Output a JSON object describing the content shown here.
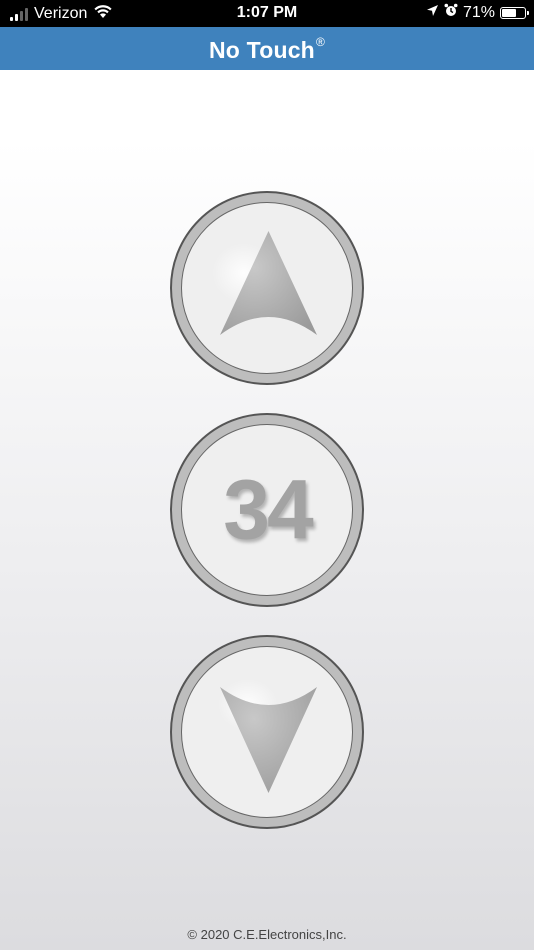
{
  "status_bar": {
    "carrier": "Verizon",
    "time": "1:07 PM",
    "battery_percent": "71%",
    "battery_level": 0.71,
    "icons": [
      "signal-icon",
      "wifi-icon",
      "location-icon",
      "alarm-icon",
      "battery-icon"
    ]
  },
  "nav": {
    "title": "No Touch",
    "registered_mark": "®",
    "background_color": "#3f82bd"
  },
  "controls": {
    "up_button": {
      "icon": "arrow-up-icon"
    },
    "floor_display": {
      "value": "34"
    },
    "down_button": {
      "icon": "arrow-down-icon"
    }
  },
  "footer": {
    "copyright": "© 2020 C.E.Electronics,Inc."
  }
}
